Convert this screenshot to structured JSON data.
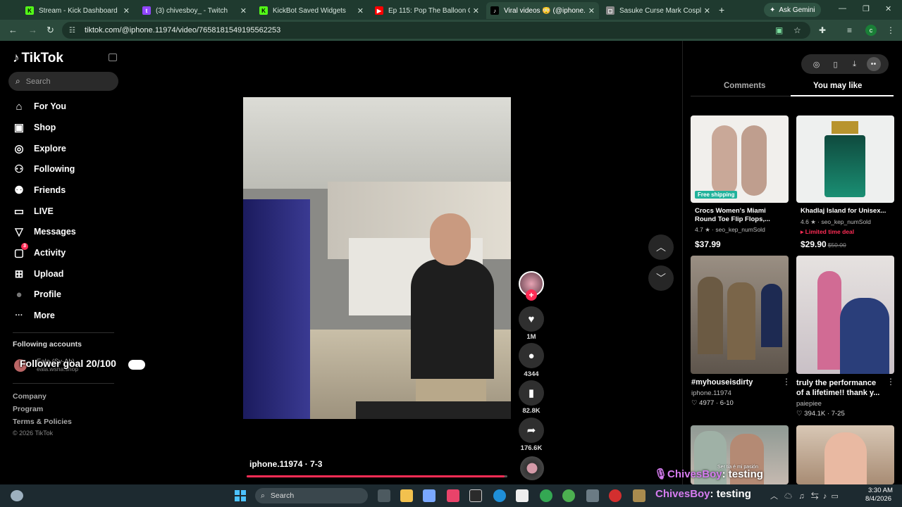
{
  "browser": {
    "tabs": [
      {
        "title": "Stream - Kick Dashboard",
        "fav": "K",
        "favcolor": "#53fc18"
      },
      {
        "title": "(3) chivesboy_ - Twitch",
        "fav": "t",
        "favcolor": "#9146ff"
      },
      {
        "title": "KickBot Saved Widgets",
        "fav": "K",
        "favcolor": "#53fc18"
      },
      {
        "title": "Ep 115: Pop The Balloon Or",
        "fav": "▶",
        "favcolor": "#ff0000"
      },
      {
        "title": "Viral videos 😳 (@iphone.1",
        "fav": "♪",
        "favcolor": "#000000"
      },
      {
        "title": "Sasuke Curse Mark Cosplay",
        "fav": "◻",
        "favcolor": "#888888"
      }
    ],
    "new_tab": "+",
    "ask_gemini": "Ask Gemini",
    "url": "tiktok.com/@iphone.11974/video/7658181549195562253",
    "profile_initial": "c"
  },
  "sidebar": {
    "logo": "TikTok",
    "search_placeholder": "Search",
    "nav": [
      {
        "label": "For You",
        "icon": "home-icon",
        "glyph": "⌂"
      },
      {
        "label": "Shop",
        "icon": "shop-icon",
        "glyph": "▣"
      },
      {
        "label": "Explore",
        "icon": "compass-icon",
        "glyph": "◎"
      },
      {
        "label": "Following",
        "icon": "following-icon",
        "glyph": "⚇"
      },
      {
        "label": "Friends",
        "icon": "friends-icon",
        "glyph": "⚉"
      },
      {
        "label": "LIVE",
        "icon": "live-icon",
        "glyph": "▭"
      },
      {
        "label": "Messages",
        "icon": "messages-icon",
        "glyph": "▽"
      },
      {
        "label": "Activity",
        "icon": "activity-icon",
        "glyph": "▢",
        "badge": "3"
      },
      {
        "label": "Upload",
        "icon": "upload-icon",
        "glyph": "⊞"
      },
      {
        "label": "Profile",
        "icon": "profile-avatar-icon",
        "glyph": "●"
      },
      {
        "label": "More",
        "icon": "more-icon",
        "glyph": "···"
      }
    ],
    "following_header": "Following accounts",
    "following_account_name": "Eala (Sy-Ah)",
    "following_account_sub": "eala.wsha.shop",
    "follower_goal": "Follower goal 20/100",
    "footer": [
      "Company",
      "Program",
      "Terms & Policies"
    ],
    "copyright": "© 2026 TikTok"
  },
  "video": {
    "username": "iphone.11974",
    "date": "7-3",
    "progress": 0.99,
    "likes": "1M",
    "comments": "4344",
    "saves": "82.8K",
    "shares": "176.6K"
  },
  "right_panel": {
    "tabs": [
      "Comments",
      "You may like"
    ],
    "active_tab": "You may like",
    "products": [
      {
        "title": "Crocs Women's Miami\nRound Toe Flip Flops,...",
        "rating": "4.7",
        "sold": "seo_kep_numSold",
        "price": "$37.99",
        "badge": "Free shipping"
      },
      {
        "title": "Khadlaj Island for Unisex...",
        "rating": "4.6",
        "sold": "seo_kep_numSold",
        "price": "$29.90",
        "old_price": "$50.00",
        "deal": "Limited time deal"
      }
    ],
    "videos": [
      {
        "title": "#myhouseisdirty",
        "user": "iphone.11974",
        "likes": "4977",
        "date": "6-10"
      },
      {
        "title": "truly the performance of a lifetime!! thank y...",
        "user": "paiepiee",
        "likes": "394.1K",
        "date": "7-25"
      }
    ],
    "thumb_text_3": "Ser tia é mi pasión"
  },
  "overlay": {
    "name": "ChivesBoy",
    "text": "testing"
  },
  "taskbar": {
    "search": "Search",
    "time": "3:30 AM",
    "date": "8/4/2026"
  }
}
